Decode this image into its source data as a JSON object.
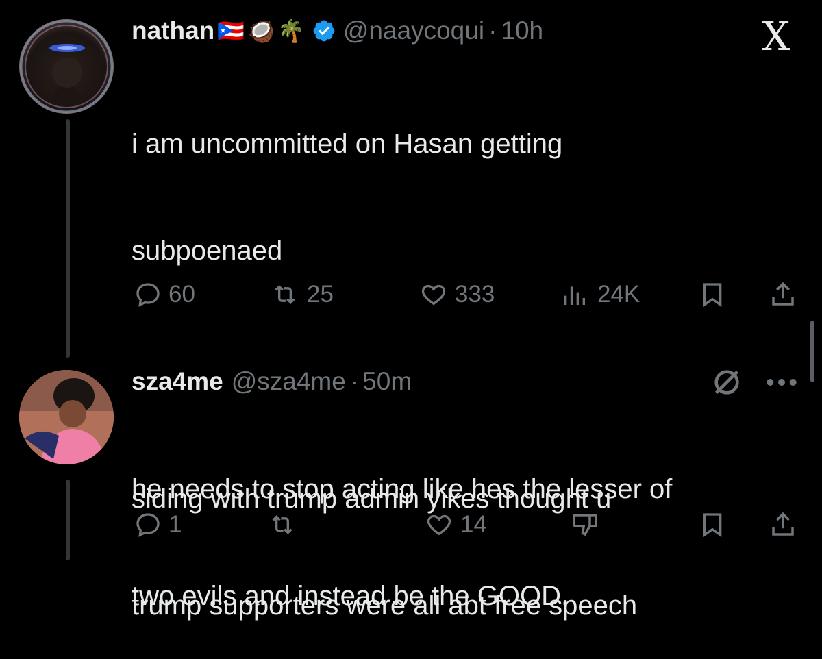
{
  "tweet1": {
    "name": "nathan",
    "emojis": [
      "🇵🇷",
      "🥥",
      "🌴"
    ],
    "handle": "@naaycoqui",
    "separator": "·",
    "time": "10h",
    "text_line1": "i am uncommitted on Hasan getting",
    "text_line2": "subpoenaed",
    "text_line3": "he needs to stop acting like hes the lesser of",
    "text_line4": "two evils and instead be the GOOD.",
    "replies": "60",
    "reposts": "25",
    "likes": "333",
    "views": "24K",
    "brand_icon": "X"
  },
  "tweet2": {
    "name": "sza4me",
    "handle": "@sza4me",
    "separator": "·",
    "time": "50m",
    "text_line1": "siding with trump admin yikes thought u",
    "text_line2": "trump supporters were all abt free speech",
    "replies": "1",
    "reposts": "",
    "likes": "14"
  },
  "colors": {
    "background": "#000000",
    "text": "#e7e9ea",
    "muted": "#71767b",
    "verified": "#1d9bf0"
  },
  "icons": [
    "reply-icon",
    "repost-icon",
    "like-icon",
    "views-icon",
    "bookmark-icon",
    "share-icon",
    "grok-icon",
    "more-icon",
    "downvote-icon",
    "verified-icon",
    "x-logo-icon"
  ]
}
